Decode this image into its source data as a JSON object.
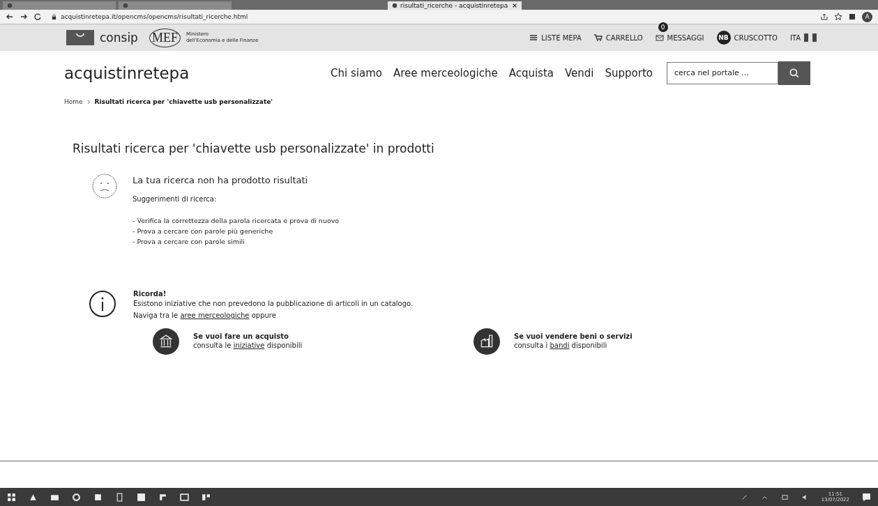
{
  "browser": {
    "tabs": [
      {
        "selected": false
      },
      {
        "selected": false
      },
      {
        "label": "risultati_ricerche - acquistinretepa",
        "selected": true
      }
    ],
    "url": "acquistinretepa.it/opencms/opencms/risultati_ricerche.html",
    "profile": "A"
  },
  "topbar": {
    "consip": "consip",
    "mef": "MEF",
    "ministry": [
      "Ministero",
      "dell'Economia e delle Finanze"
    ],
    "links": [
      {
        "kind": "menu",
        "label": "LISTE MEPA"
      },
      {
        "kind": "cart",
        "label": "CARRELLO"
      },
      {
        "kind": "mail",
        "label": "MESSAGGI",
        "badge": "0"
      },
      {
        "kind": "avatar",
        "label": "CRUSCOTTO",
        "initials": "NB"
      },
      {
        "kind": "lang",
        "label": "ITA"
      }
    ]
  },
  "nav": {
    "brand": "acquistinretepa",
    "items": [
      "Chi siamo",
      "Aree merceologiche",
      "Acquista",
      "Vendi",
      "Supporto"
    ],
    "search": {
      "placeholder": "cerca nel portale ..."
    }
  },
  "breadcrumb": [
    "Home",
    "Risultati ricerca per 'chiavette usb personalizzate'"
  ],
  "heading": "Risultati ricerca per 'chiavette usb personalizzate' in prodotti",
  "no_results": {
    "title": "La tua ricerca non ha prodotto risultati",
    "subtitle": "Suggerimenti di ricerca:",
    "suggestions": [
      "- Verifica la correttezza della parola ricercata e prova di nuovo",
      "- Prova a cercare con parole più generiche",
      "- Prova a cercare con parole simili"
    ]
  },
  "notice": {
    "title": "Ricorda!",
    "text": "Esistono iniziative che non prevedono la pubblicazione di articoli in un catalogo.",
    "nav_before": "Naviga tra le",
    "nav_link": "aree merceologiche",
    "nav_after": "oppure"
  },
  "actions": [
    {
      "kind": "buy",
      "title": "Se vuoi fare un acquisto",
      "before": "consulta le",
      "link": "iniziative",
      "after": "disponibili"
    },
    {
      "kind": "sell",
      "title": "Se vuoi vendere beni o servizi",
      "before": "consulta i",
      "link": "bandi",
      "after": "disponibili"
    }
  ],
  "taskbar": {
    "time": "11:51",
    "date": "13/07/2022"
  }
}
